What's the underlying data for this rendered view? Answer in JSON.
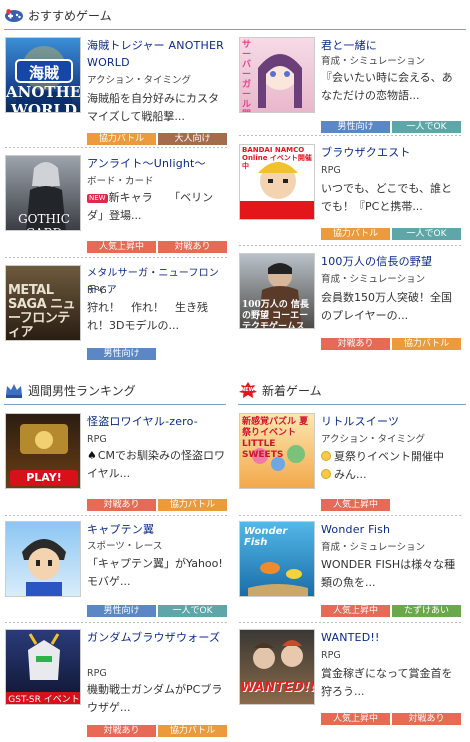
{
  "sections": {
    "recommended": {
      "title": "おすすめゲーム"
    },
    "ranking": {
      "title": "週間男性ランキング"
    },
    "new": {
      "title": "新着ゲーム",
      "icon_label": "NEW"
    }
  },
  "games": [
    {
      "title": "海賊トレジャー ANOTHER WORLD",
      "genre": "アクション・タイミング",
      "desc": "海賊船を自分好みにカスタマイズして戦船撃...",
      "badges": [
        "協力バトル",
        "大人向け"
      ],
      "thumb_text": "海賊 ANOTHER WORLD"
    },
    {
      "title": "君と一緒に",
      "genre": "育成・シミュレーション",
      "desc": "『会いたい時に会える、あなただけの恋物語...",
      "badges": [
        "男性向け",
        "一人でOK"
      ],
      "thumb_text": "サーバーガール 開催"
    },
    {
      "title": "アンライト～Unlight～",
      "genre": "ボード・カード",
      "new_label": "NEW",
      "desc": "新キャラ　　「ベリンダ」登場...",
      "badges": [
        "人気上昇中",
        "対戦あり"
      ],
      "thumb_text": "GOTHIC CARD GAME アンライト"
    },
    {
      "title": "ブラウザクエスト",
      "genre": "RPG",
      "desc": "いつでも、どこでも、誰とでも！『PCと携帯...",
      "badges": [
        "協力バトル",
        "一人でOK"
      ],
      "thumb_text": "BANDAI NAMCO Online イベント開催中"
    },
    {
      "title": "メタルサーガ・ニューフロンティア",
      "genre": "RPG",
      "desc": "狩れ！　作れ！　生き残れ！3Dモデルの...",
      "badges": [
        "男性向け"
      ],
      "thumb_text": "METAL SAGA ニューフロンティア"
    },
    {
      "title": "100万人の信長の野望",
      "genre": "育成・シミュレーション",
      "desc": "会員数150万人突破！全国のプレイヤーの...",
      "badges": [
        "対戦あり",
        "協力バトル"
      ],
      "thumb_text": "100万人の 信長の野望 コーエーテクモゲームス"
    },
    {
      "title": "怪盗ロワイヤル-zero-",
      "genre": "RPG",
      "desc": "CMでお馴染みの怪盗ロワイヤル...",
      "badges": [
        "対戦あり",
        "協力バトル"
      ],
      "thumb_text": "PLAY!"
    },
    {
      "title": "リトルスイーツ",
      "genre": "アクション・タイミング",
      "desc_lines": [
        "夏祭りイベント開催中",
        "みん..."
      ],
      "badges": [
        "人気上昇中"
      ],
      "thumb_text": "新感覚パズル 夏祭りイベント LITTLE SWEETS"
    },
    {
      "title": "キャプテン翼",
      "genre": "スポーツ・レース",
      "desc": "「キャプテン翼」がYahoo!モバゲ...",
      "badges": [
        "男性向け",
        "一人でOK"
      ],
      "thumb_text": ""
    },
    {
      "title": "Wonder Fish",
      "genre": "育成・シミュレーション",
      "desc": "WONDER FISHは様々な種類の魚を...",
      "badges": [
        "人気上昇中",
        "たずけあい"
      ],
      "thumb_text": "Wonder Fish"
    },
    {
      "title": "ガンダムブラウザウォーズ",
      "genre": "RPG",
      "desc": "機動戦士ガンダムがPCブラウザゲ...",
      "badges": [
        "対戦あり",
        "協力バトル"
      ],
      "thumb_text": "GST-SR イベント中！"
    },
    {
      "title": "WANTED!!",
      "genre": "RPG",
      "desc": "賞金稼ぎになって賞金首を狩ろう...",
      "badges": [
        "人気上昇中",
        "対戦あり"
      ],
      "thumb_text": "WANTED!!"
    }
  ],
  "colors": {
    "title_link": "#0a2a8a",
    "rule": "#7f9fcf"
  }
}
